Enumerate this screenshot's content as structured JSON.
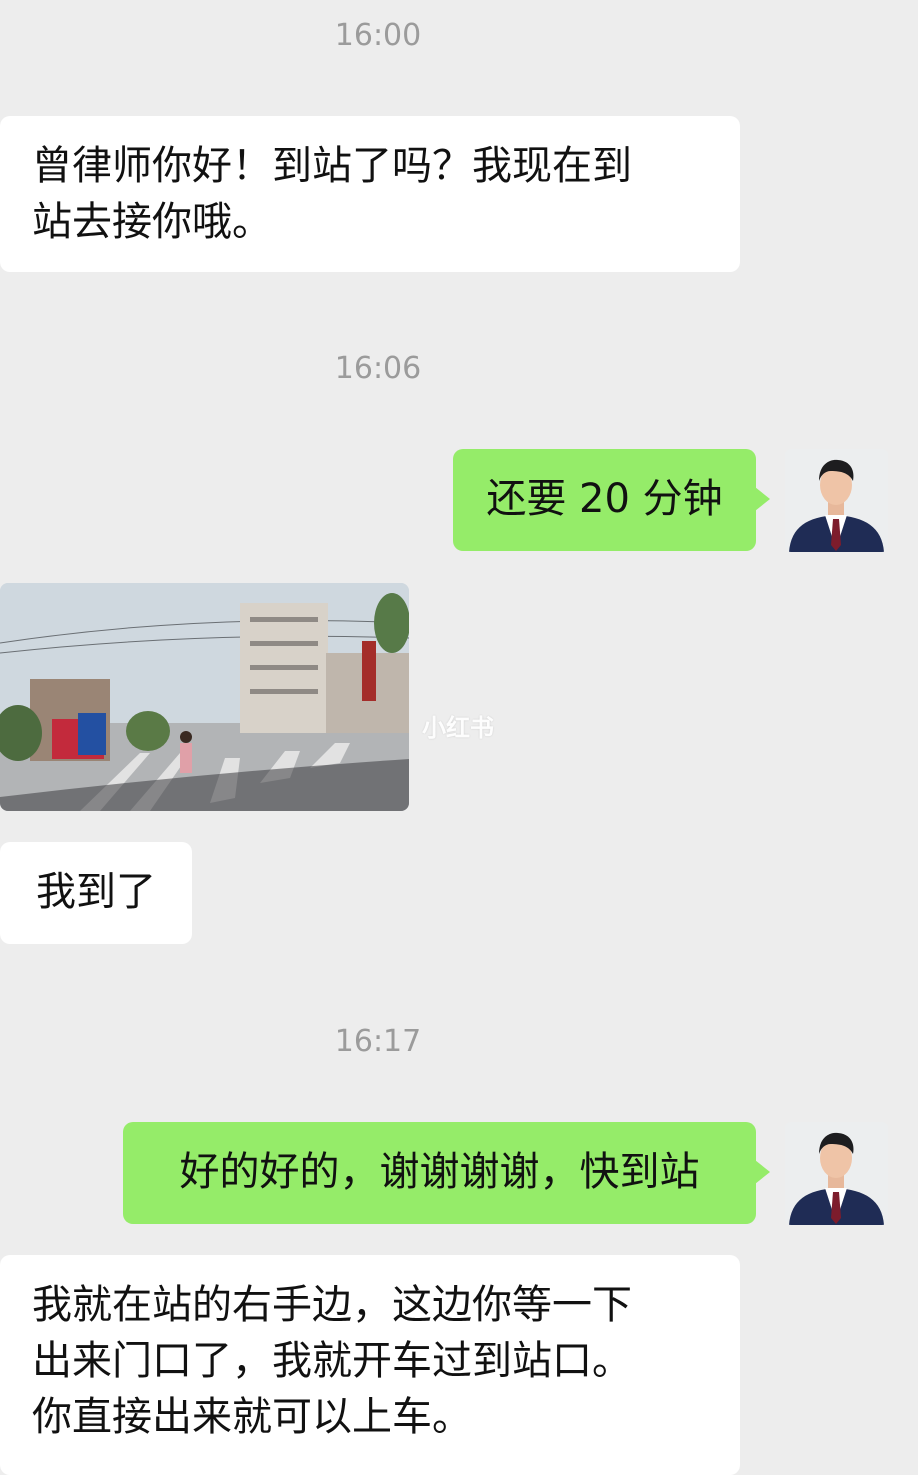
{
  "chat": {
    "messages": [
      {
        "type": "time",
        "text": "16:00"
      },
      {
        "type": "incoming",
        "text": "曾律师你好！到站了吗？我现在到站去接你哦。"
      },
      {
        "type": "time",
        "text": "16:06"
      },
      {
        "type": "outgoing",
        "text": "还要 20 分钟"
      },
      {
        "type": "incoming-image",
        "description": "street photo"
      },
      {
        "type": "incoming",
        "text": "我到了"
      },
      {
        "type": "time",
        "text": "16:17"
      },
      {
        "type": "outgoing",
        "text": "好的好的，谢谢谢谢，快到站"
      },
      {
        "type": "incoming",
        "text": "我就在站的右手边，这边你等一下出来门口了，我就开车过到站口。你直接出来就可以上车。"
      }
    ],
    "line_breaks": {
      "msg1_line1": "曾律师你好！到站了吗？我现在到",
      "msg1_line2": "站去接你哦。",
      "msg8_line1": "我就在站的右手边，这边你等一下",
      "msg8_line2": "出来门口了，我就开车过到站口。",
      "msg8_line3": "你直接出来就可以上车。"
    }
  },
  "watermark": "小红书",
  "colors": {
    "background": "#ededed",
    "incoming_bubble": "#ffffff",
    "outgoing_bubble": "#95ec69",
    "timestamp": "#9b9b9b"
  }
}
